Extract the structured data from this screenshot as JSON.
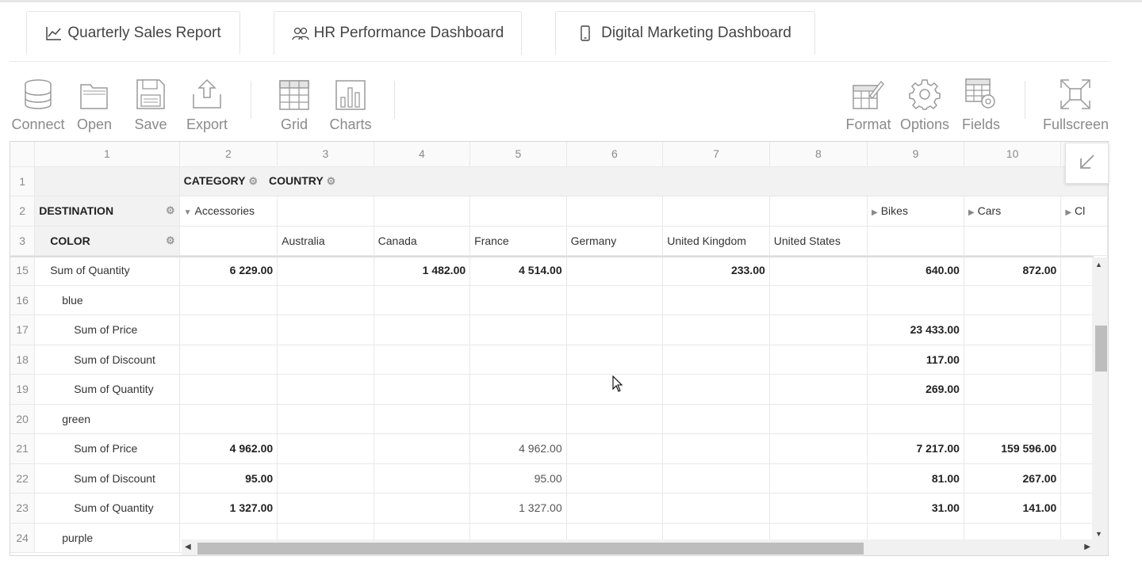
{
  "tabs": [
    {
      "label": "Quarterly Sales Report",
      "icon": "line-chart-icon"
    },
    {
      "label": "HR Performance Dashboard",
      "icon": "people-icon"
    },
    {
      "label": "Digital Marketing Dashboard",
      "icon": "mobile-icon"
    }
  ],
  "toolbar": {
    "connect": "Connect",
    "open": "Open",
    "save": "Save",
    "export": "Export",
    "grid": "Grid",
    "charts": "Charts",
    "format": "Format",
    "options": "Options",
    "fields": "Fields",
    "fullscreen": "Fullscreen"
  },
  "grid": {
    "col_numbers": [
      "1",
      "2",
      "3",
      "4",
      "5",
      "6",
      "7",
      "8",
      "9",
      "10"
    ],
    "row_numbers": [
      "1",
      "2",
      "3",
      "15",
      "16",
      "17",
      "18",
      "19",
      "20",
      "21",
      "22",
      "23",
      "24"
    ],
    "filters": {
      "category": "CATEGORY",
      "country": "COUNTRY",
      "destination": "DESTINATION",
      "color": "COLOR"
    },
    "col_members": {
      "accessories": "Accessories",
      "bikes": "Bikes",
      "cars": "Cars",
      "cl": "Cl"
    },
    "countries": [
      "Australia",
      "Canada",
      "France",
      "Germany",
      "United Kingdom",
      "United States"
    ],
    "rows": [
      {
        "label": "Sum of Quantity",
        "indent": 1,
        "values": [
          "6 229.00",
          "",
          "1 482.00",
          "4 514.00",
          "",
          "233.00",
          "",
          "640.00",
          "872.00"
        ],
        "bold": [
          true,
          false,
          true,
          true,
          false,
          true,
          false,
          true,
          true
        ]
      },
      {
        "label": "blue",
        "indent": 2,
        "values": [
          "",
          "",
          "",
          "",
          "",
          "",
          "",
          "",
          ""
        ],
        "bold": [
          false,
          false,
          false,
          false,
          false,
          false,
          false,
          false,
          false
        ]
      },
      {
        "label": "Sum of Price",
        "indent": 3,
        "values": [
          "",
          "",
          "",
          "",
          "",
          "",
          "",
          "23 433.00",
          ""
        ],
        "bold": [
          false,
          false,
          false,
          false,
          false,
          false,
          false,
          true,
          false
        ]
      },
      {
        "label": "Sum of Discount",
        "indent": 3,
        "values": [
          "",
          "",
          "",
          "",
          "",
          "",
          "",
          "117.00",
          ""
        ],
        "bold": [
          false,
          false,
          false,
          false,
          false,
          false,
          false,
          true,
          false
        ]
      },
      {
        "label": "Sum of Quantity",
        "indent": 3,
        "values": [
          "",
          "",
          "",
          "",
          "",
          "",
          "",
          "269.00",
          ""
        ],
        "bold": [
          false,
          false,
          false,
          false,
          false,
          false,
          false,
          true,
          false
        ]
      },
      {
        "label": "green",
        "indent": 2,
        "values": [
          "",
          "",
          "",
          "",
          "",
          "",
          "",
          "",
          ""
        ],
        "bold": [
          false,
          false,
          false,
          false,
          false,
          false,
          false,
          false,
          false
        ]
      },
      {
        "label": "Sum of Price",
        "indent": 3,
        "values": [
          "4 962.00",
          "",
          "",
          "4 962.00",
          "",
          "",
          "",
          "7 217.00",
          "159 596.00"
        ],
        "bold": [
          true,
          false,
          false,
          false,
          false,
          false,
          false,
          true,
          true
        ]
      },
      {
        "label": "Sum of Discount",
        "indent": 3,
        "values": [
          "95.00",
          "",
          "",
          "95.00",
          "",
          "",
          "",
          "81.00",
          "267.00"
        ],
        "bold": [
          true,
          false,
          false,
          false,
          false,
          false,
          false,
          true,
          true
        ]
      },
      {
        "label": "Sum of Quantity",
        "indent": 3,
        "values": [
          "1 327.00",
          "",
          "",
          "1 327.00",
          "",
          "",
          "",
          "31.00",
          "141.00"
        ],
        "bold": [
          true,
          false,
          false,
          false,
          false,
          false,
          false,
          true,
          true
        ]
      },
      {
        "label": "purple",
        "indent": 2,
        "values": [
          "",
          "",
          "",
          "",
          "",
          "",
          "",
          "",
          ""
        ],
        "bold": [
          false,
          false,
          false,
          false,
          false,
          false,
          false,
          false,
          false
        ]
      }
    ]
  }
}
